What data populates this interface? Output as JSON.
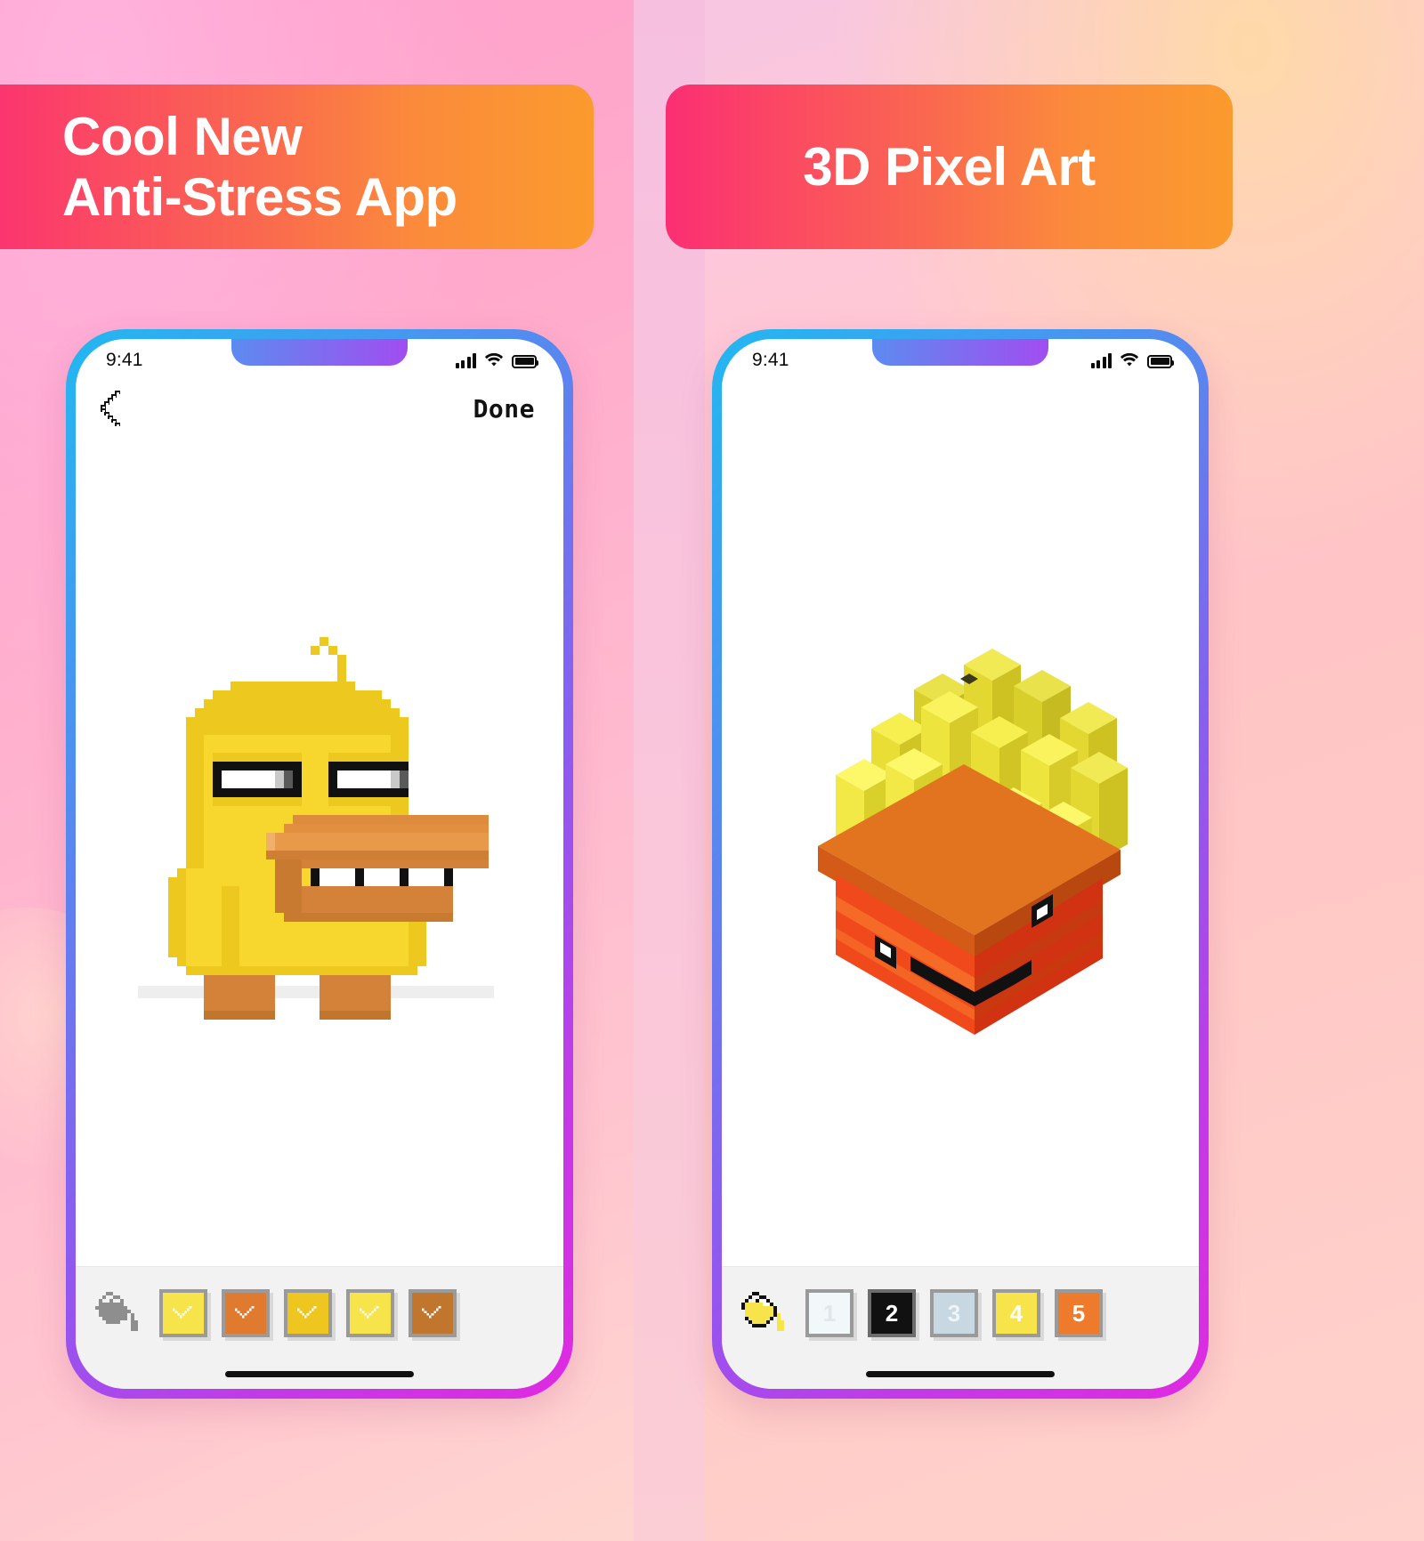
{
  "colors": {
    "banner_gradient_start": "#fb2e73",
    "banner_gradient_end": "#fb9a2e",
    "phone_border_start": "#22b8f0",
    "phone_border_end": "#e02ae0",
    "bg_left": "#ff9ecb",
    "bg_right": "#ffc8d6",
    "palette_bar": "#f2f2f2",
    "duck_body": "#f7d72e",
    "duck_beak": "#d4813a",
    "fries_potato": "#f2e03a",
    "fries_box": "#ef3f23"
  },
  "panels": [
    {
      "id": "left",
      "banner": {
        "text": "Cool New\nAnti-Stress App",
        "align": "left"
      },
      "phone": {
        "status_bar": {
          "time": "9:41",
          "icons": [
            "cellular-signal-icon",
            "wifi-icon",
            "battery-icon"
          ]
        },
        "nav_bar": {
          "back_label": "back-chevron-icon",
          "done_label": "Done"
        },
        "artwork": {
          "name": "pixel-duck",
          "type": "2d-pixel-art"
        },
        "palette": {
          "tool": {
            "name": "paint-bucket-tool",
            "state": "inactive",
            "color": "#8e8e8e"
          },
          "swatches": [
            {
              "color": "#f7e34a",
              "selected": true,
              "label": ""
            },
            {
              "color": "#e07a2e",
              "selected": true,
              "label": ""
            },
            {
              "color": "#eec61f",
              "selected": true,
              "label": ""
            },
            {
              "color": "#f7e34a",
              "selected": true,
              "label": ""
            },
            {
              "color": "#c0762c",
              "selected": true,
              "label": ""
            }
          ]
        },
        "home_indicator": true
      }
    },
    {
      "id": "right",
      "banner": {
        "text": "3D Pixel Art",
        "align": "center"
      },
      "phone": {
        "status_bar": {
          "time": "9:41",
          "icons": [
            "cellular-signal-icon",
            "wifi-icon",
            "battery-icon"
          ]
        },
        "nav_bar": {
          "back_label": "",
          "done_label": ""
        },
        "artwork": {
          "name": "voxel-french-fries",
          "type": "3d-voxel-art"
        },
        "palette": {
          "tool": {
            "name": "paint-bucket-tool",
            "state": "active",
            "color": "#f7e34a"
          },
          "swatches": [
            {
              "color": "#f2f7f9",
              "selected": false,
              "label": "1"
            },
            {
              "color": "#111111",
              "selected": true,
              "label": "2"
            },
            {
              "color": "#c7d8e2",
              "selected": false,
              "label": "3"
            },
            {
              "color": "#f7e34a",
              "selected": false,
              "label": "4"
            },
            {
              "color": "#ee7b2c",
              "selected": false,
              "label": "5"
            }
          ]
        },
        "home_indicator": true
      }
    }
  ]
}
